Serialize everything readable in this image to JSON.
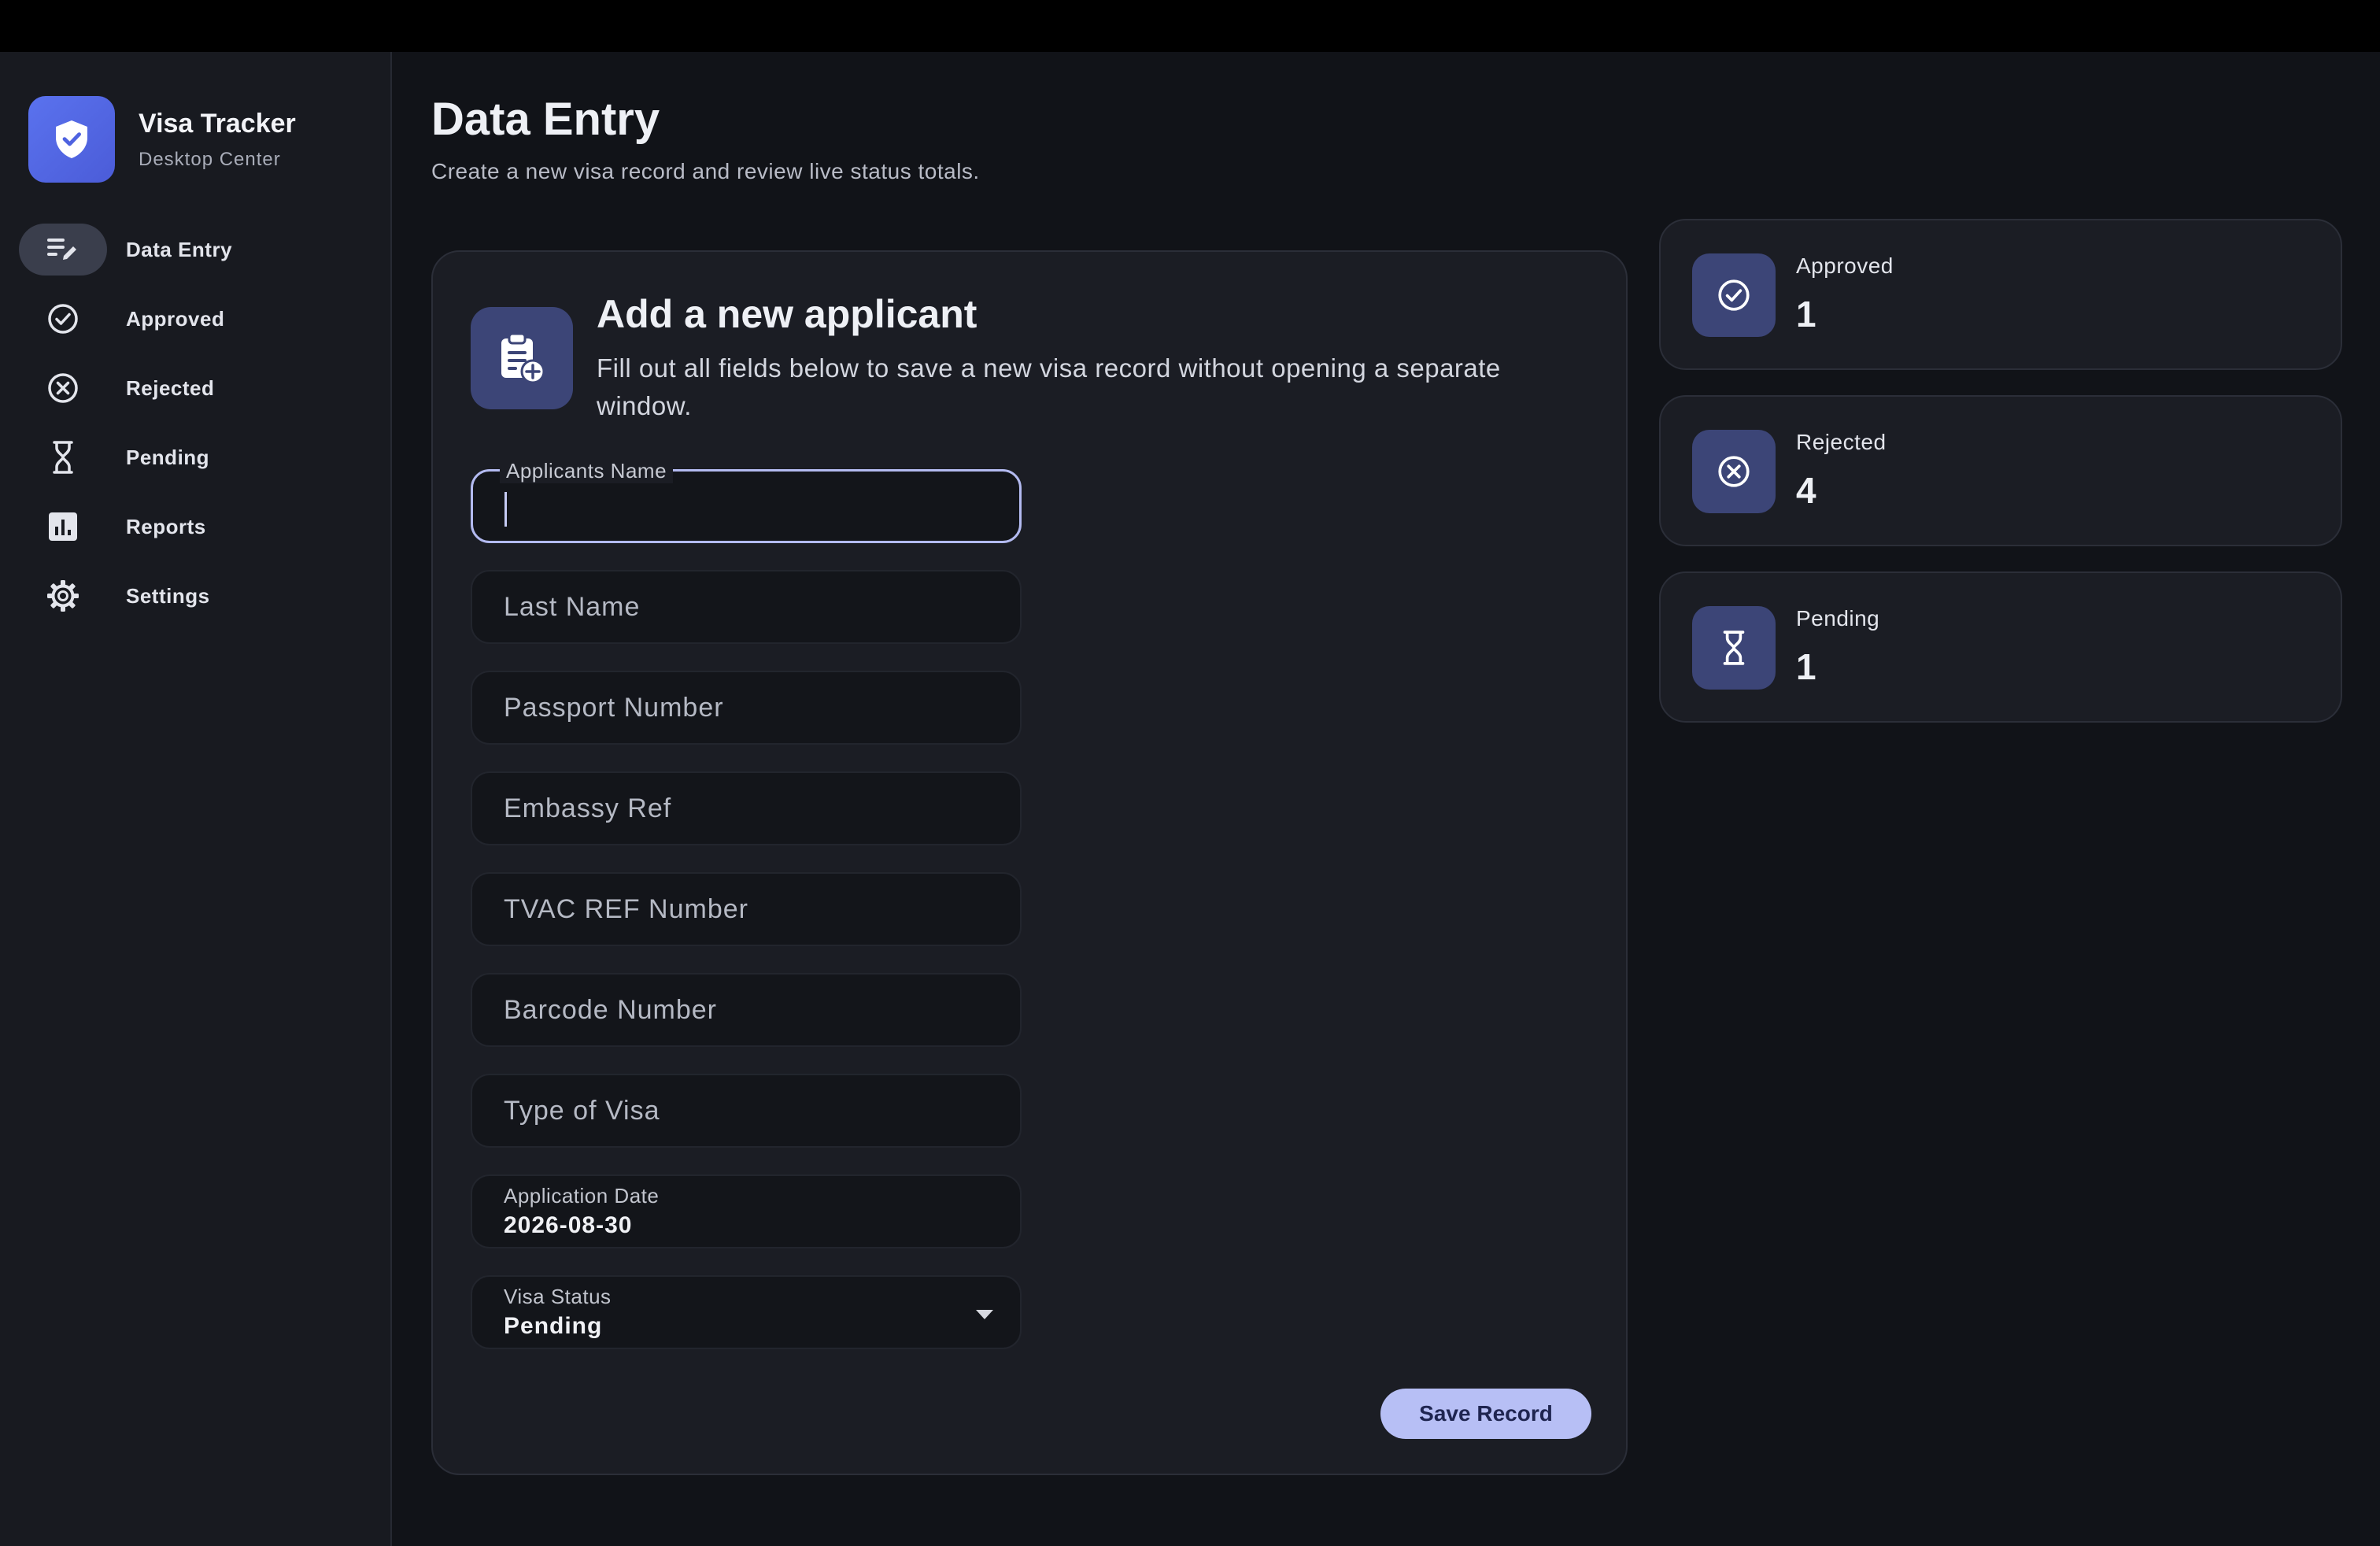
{
  "brand": {
    "title": "Visa Tracker",
    "subtitle": "Desktop Center",
    "logo_icon": "shield-check-icon"
  },
  "nav": [
    {
      "label": "Data Entry",
      "icon": "edit-list-icon",
      "active": true
    },
    {
      "label": "Approved",
      "icon": "check-circle-icon",
      "active": false
    },
    {
      "label": "Rejected",
      "icon": "x-circle-icon",
      "active": false
    },
    {
      "label": "Pending",
      "icon": "hourglass-icon",
      "active": false
    },
    {
      "label": "Reports",
      "icon": "bar-chart-icon",
      "active": false
    },
    {
      "label": "Settings",
      "icon": "gear-icon",
      "active": false
    }
  ],
  "page": {
    "title": "Data Entry",
    "subtitle": "Create a new visa record and review live status totals."
  },
  "form": {
    "title": "Add a new applicant",
    "description": "Fill out all fields below to save a new visa record without opening a separate window.",
    "fields": [
      {
        "label": "Applicants Name",
        "value": "",
        "placeholder": ""
      },
      {
        "label": "",
        "value": "",
        "placeholder": "Last Name"
      },
      {
        "label": "",
        "value": "",
        "placeholder": "Passport Number"
      },
      {
        "label": "",
        "value": "",
        "placeholder": "Embassy Ref"
      },
      {
        "label": "",
        "value": "",
        "placeholder": "TVAC REF Number"
      },
      {
        "label": "",
        "value": "",
        "placeholder": "Barcode Number"
      },
      {
        "label": "",
        "value": "",
        "placeholder": "Type of Visa"
      }
    ],
    "application_date": {
      "label": "Application Date",
      "value": "2026-08-30"
    },
    "visa_status": {
      "label": "Visa Status",
      "value": "Pending"
    },
    "save_label": "Save Record"
  },
  "stats": [
    {
      "label": "Approved",
      "value": "1",
      "icon": "check-circle-icon"
    },
    {
      "label": "Rejected",
      "value": "4",
      "icon": "x-circle-icon"
    },
    {
      "label": "Pending",
      "value": "1",
      "icon": "hourglass-icon"
    }
  ],
  "colors": {
    "accent": "#b7bff5",
    "icon_tile": "#3c4577",
    "brand_gradient_start": "#5a72ee",
    "brand_gradient_end": "#4b5cd8",
    "background": "#111318",
    "card": "#1b1d24"
  }
}
